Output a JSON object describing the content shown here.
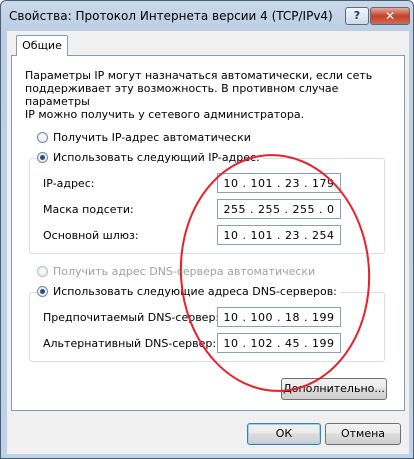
{
  "window": {
    "title": "Свойства: Протокол Интернета версии 4 (TCP/IPv4)",
    "help_label": "?",
    "close_label": "✕"
  },
  "tabs": [
    {
      "label": "Общие",
      "active": true
    }
  ],
  "description": "Параметры IP могут назначаться автоматически, если сеть\nподдерживает эту возможность. В противном случае параметры\nIP можно получить у сетевого администратора.",
  "ip": {
    "auto_label": "Получить IP-адрес автоматически",
    "manual_label": "Использовать следующий IP-адрес:",
    "mode": "manual",
    "fields": [
      {
        "label": "IP-адрес:",
        "value": "10 . 101 . 23 . 179"
      },
      {
        "label": "Маска подсети:",
        "value": "255 . 255 . 255 . 0"
      },
      {
        "label": "Основной шлюз:",
        "value": "10 . 101 . 23 . 254"
      }
    ]
  },
  "dns": {
    "auto_label": "Получить адрес DNS-сервера автоматически",
    "auto_enabled": false,
    "manual_label": "Использовать следующие адреса DNS-серверов:",
    "mode": "manual",
    "fields": [
      {
        "label": "Предпочитаемый DNS-сервер:",
        "value": "10 . 100 . 18 . 199"
      },
      {
        "label": "Альтернативный DNS-сервер:",
        "value": "10 . 102 . 45 . 199"
      }
    ]
  },
  "buttons": {
    "advanced": "Дополнительно...",
    "ok": "ОК",
    "cancel": "Отмена"
  },
  "colors": {
    "annotation_circle": "#e8202a",
    "selected_radio": "#264f8a"
  }
}
